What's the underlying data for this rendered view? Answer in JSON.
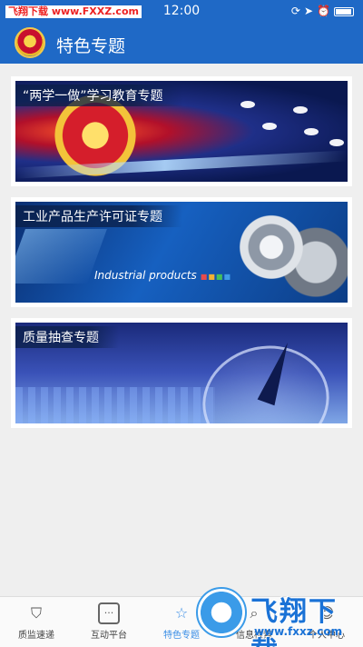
{
  "status_bar": {
    "watermark": "飞翔下载 www.FXXZ.com",
    "time": "12:00",
    "icons": [
      "orientation-lock-icon",
      "location-icon",
      "alarm-icon",
      "battery-icon"
    ]
  },
  "header": {
    "title": "特色专题"
  },
  "topics": [
    {
      "title": "“两学一做”学习教育专题"
    },
    {
      "title": "工业产品生产许可证专题",
      "subtitle": "Industrial products"
    },
    {
      "title": "质量抽查专题"
    }
  ],
  "tabbar": {
    "items": [
      {
        "label": "质监速递",
        "icon": "shield-doc-icon"
      },
      {
        "label": "互动平台",
        "icon": "chat-box-icon"
      },
      {
        "label": "特色专题",
        "icon": "star-icon",
        "active": true
      },
      {
        "label": "信息检索",
        "icon": "search-icon"
      },
      {
        "label": "个人中心",
        "icon": "person-icon"
      }
    ]
  },
  "watermark_overlay": {
    "text": "飞翔下载",
    "url": "www.fxxz.com"
  },
  "colors": {
    "header_bg": "#1f69c6",
    "active_tab": "#3a8ee6"
  }
}
